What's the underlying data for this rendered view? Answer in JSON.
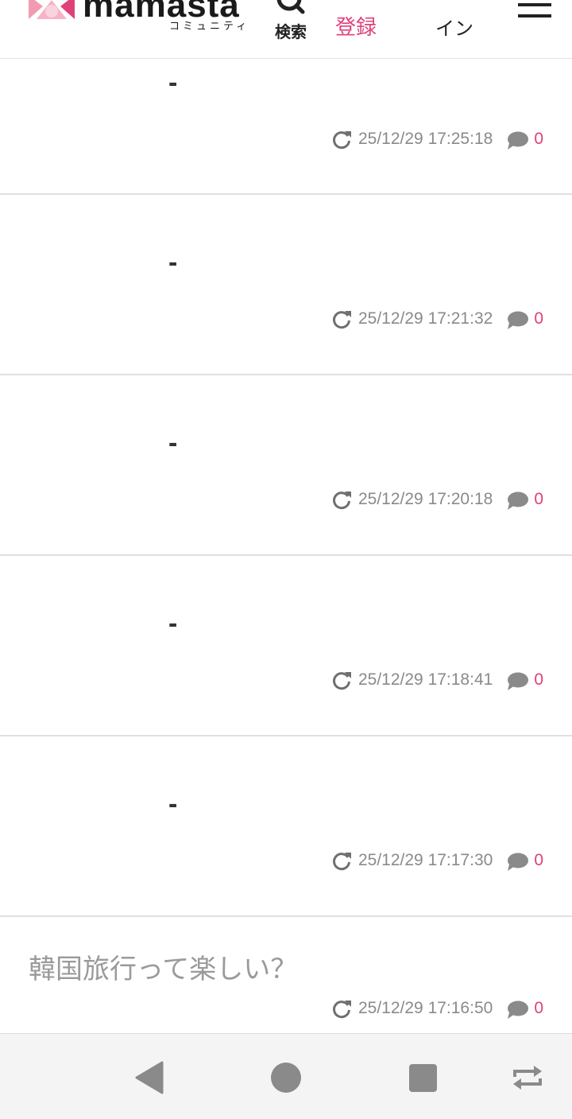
{
  "header": {
    "logo_text": "mamasta",
    "logo_sub": "コミュニティ",
    "search_label": "検索",
    "register_label": "登録",
    "login_label": "イン"
  },
  "posts": [
    {
      "title": "-",
      "timestamp": "25/12/29 17:25:18",
      "comments": "0"
    },
    {
      "title": "-",
      "timestamp": "25/12/29 17:21:32",
      "comments": "0"
    },
    {
      "title": "-",
      "timestamp": "25/12/29 17:20:18",
      "comments": "0"
    },
    {
      "title": "-",
      "timestamp": "25/12/29 17:18:41",
      "comments": "0"
    },
    {
      "title": "-",
      "timestamp": "25/12/29 17:17:30",
      "comments": "0"
    },
    {
      "title": "韓国旅行って楽しい？",
      "timestamp": "25/12/29 17:16:50",
      "comments": "0"
    }
  ],
  "colors": {
    "accent": "#e0407a",
    "logo_pink": "#f7b3c4",
    "meta_gray": "#8a8a8a"
  },
  "icons": {
    "search": "search-icon",
    "menu": "hamburger-menu-icon",
    "refresh": "refresh-icon",
    "comment": "speech-bubble-icon",
    "nav_back": "back-triangle-icon",
    "nav_home": "home-circle-icon",
    "nav_recent": "recent-apps-square-icon",
    "nav_rotate": "rotate-icon"
  }
}
